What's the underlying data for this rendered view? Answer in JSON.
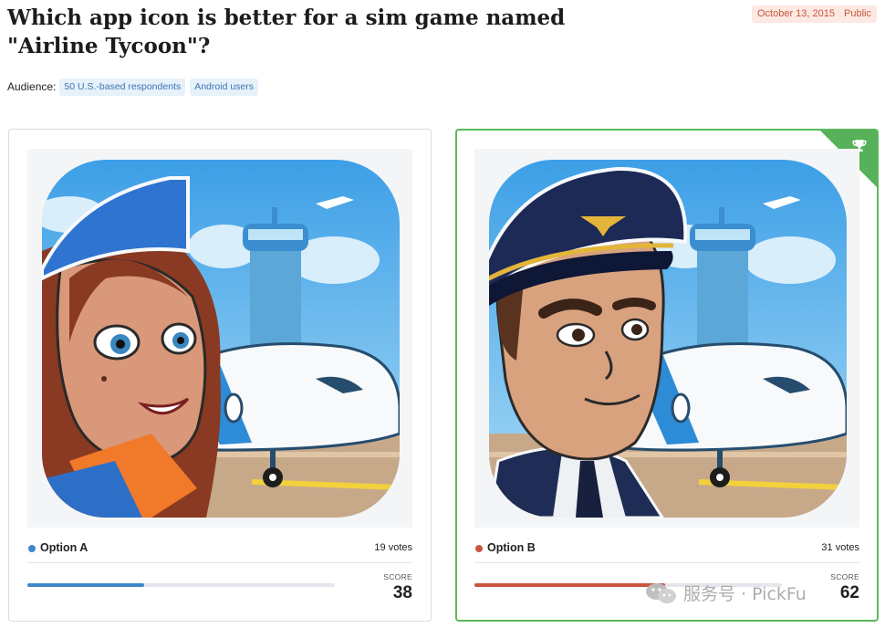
{
  "poll": {
    "title": "Which app icon is better for a sim game named \"Airline Tycoon\"?",
    "date": "October 13, 2015",
    "visibility": "Public"
  },
  "audience": {
    "label": "Audience:",
    "tags": [
      "50 U.S.-based respondents",
      "Android users"
    ]
  },
  "options": [
    {
      "label": "Option A",
      "votes": "19 votes",
      "score_label": "SCORE",
      "score": "38",
      "score_fraction": 0.38,
      "color": "#3f87c9",
      "image": "flight-attendant-icon",
      "winner": false
    },
    {
      "label": "Option B",
      "votes": "31 votes",
      "score_label": "SCORE",
      "score": "62",
      "score_fraction": 0.62,
      "color": "#c8553d",
      "image": "pilot-icon",
      "winner": true
    }
  ],
  "watermark": {
    "text": "服务号 · PickFu"
  }
}
